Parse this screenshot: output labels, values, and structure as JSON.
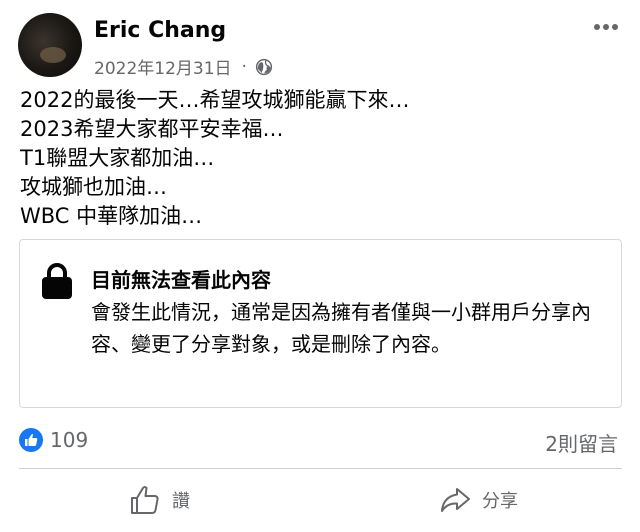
{
  "post": {
    "author": "Eric Chang",
    "date": "2022年12月31日",
    "separator": "·",
    "privacy_icon": "globe-icon",
    "more_icon": "ellipsis-icon",
    "lines": [
      "2022的最後一天…希望攻城獅能贏下來…",
      "2023希望大家都平安幸福…",
      "T1聯盟大家都加油…",
      "攻城獅也加油…",
      "WBC 中華隊加油…"
    ]
  },
  "unavailable": {
    "icon": "lock-icon",
    "title": "目前無法查看此內容",
    "body": "會發生此情況，通常是因為擁有者僅與一小群用戶分享內容、變更了分享對象，或是刪除了內容。"
  },
  "stats": {
    "reaction_icon": "like-reaction-icon",
    "like_count": "109",
    "comments": "2則留言"
  },
  "actions": {
    "like_label": "讚",
    "share_label": "分享"
  },
  "colors": {
    "text": "#050505",
    "secondary": "#65676b",
    "like_blue": "#1877f2",
    "border": "#d6d8dc"
  }
}
